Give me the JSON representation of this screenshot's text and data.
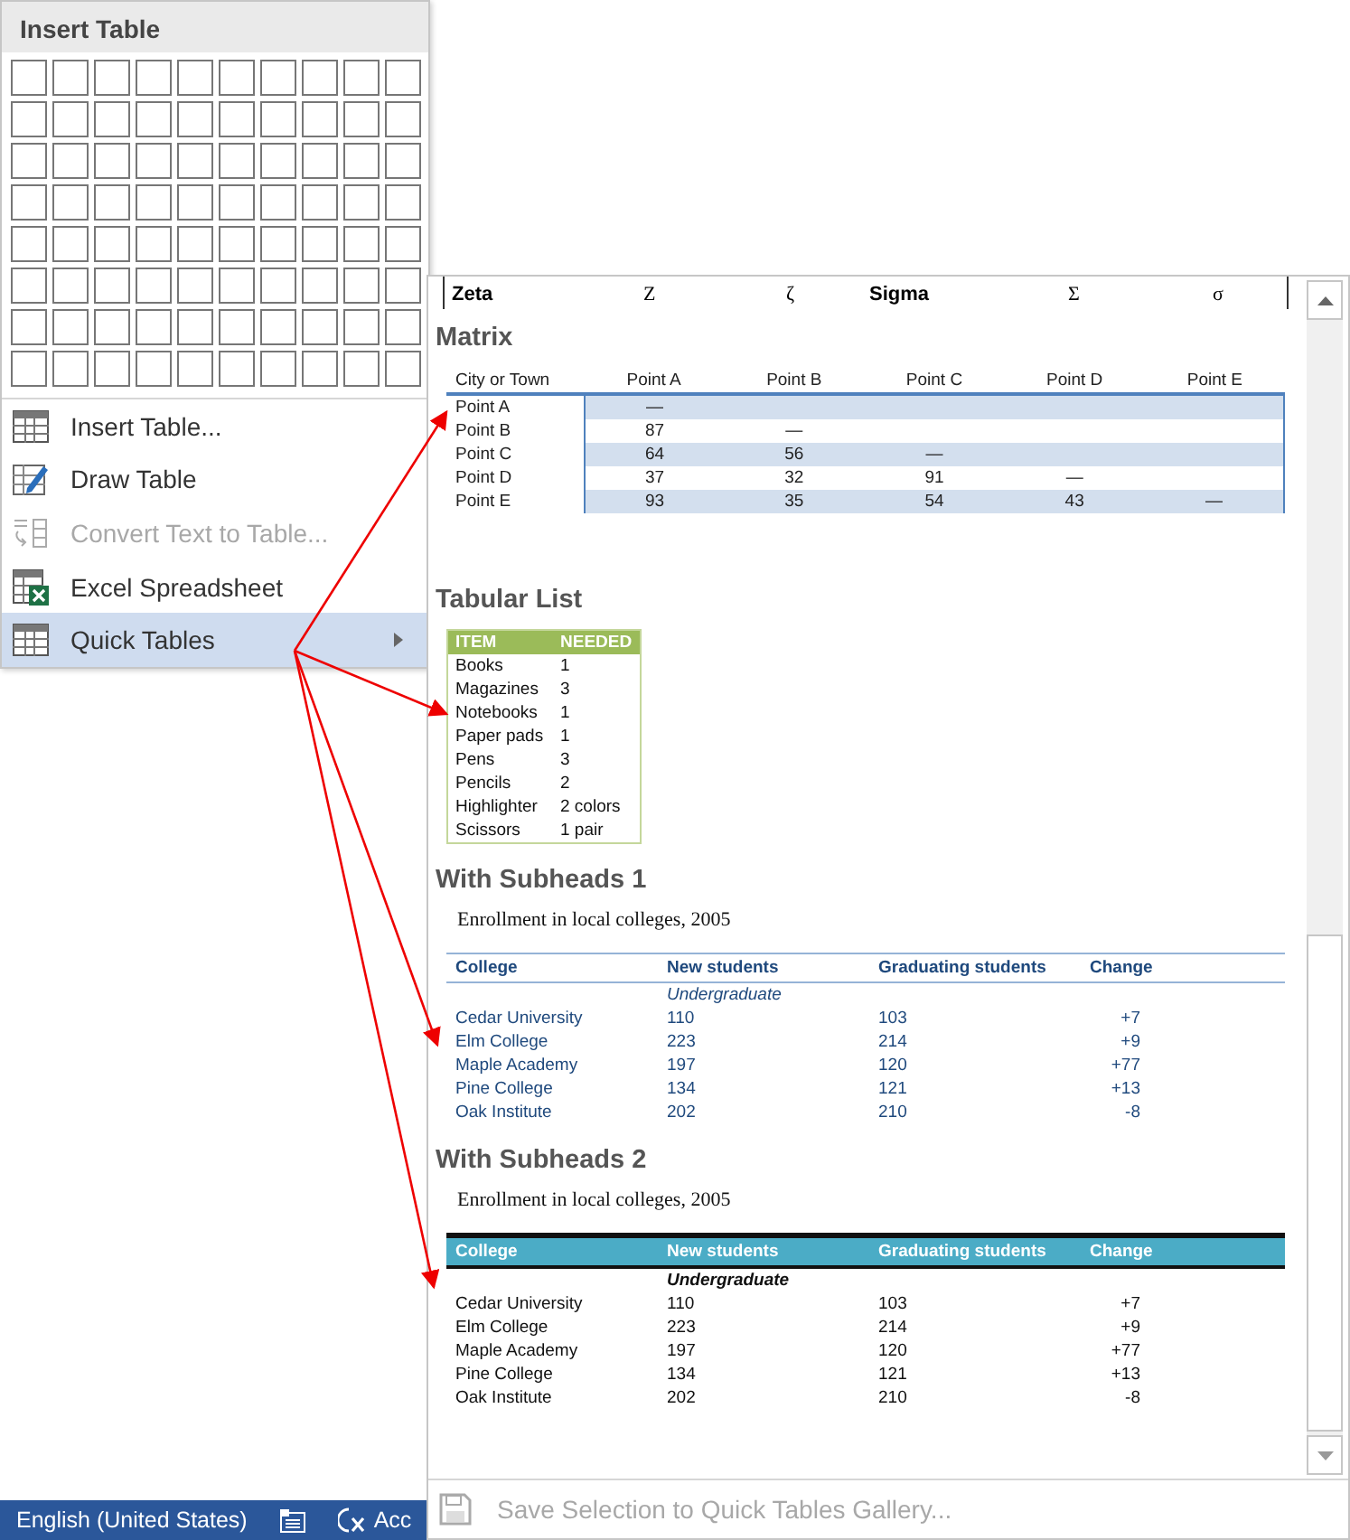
{
  "menu": {
    "title": "Insert Table",
    "items": [
      {
        "kind": "insert",
        "label": "Insert Table...",
        "disabled": false,
        "selected": false,
        "submenu": false
      },
      {
        "kind": "draw",
        "label": "Draw Table",
        "disabled": false,
        "selected": false,
        "submenu": false
      },
      {
        "kind": "convert",
        "label": "Convert Text to Table...",
        "disabled": true,
        "selected": false,
        "submenu": false
      },
      {
        "kind": "excel",
        "label": "Excel Spreadsheet",
        "disabled": false,
        "selected": false,
        "submenu": false
      },
      {
        "kind": "quick",
        "label": "Quick Tables",
        "disabled": false,
        "selected": true,
        "submenu": true
      }
    ]
  },
  "gallery": {
    "partial_row": [
      "Zeta",
      "Ζ",
      "ζ",
      "Sigma",
      "Σ",
      "σ"
    ],
    "sections": [
      {
        "kind": "matrix",
        "title": "Matrix",
        "columns": [
          "City or Town",
          "Point A",
          "Point B",
          "Point C",
          "Point D",
          "Point E"
        ],
        "rows": [
          [
            "Point A",
            "—"
          ],
          [
            "Point B",
            "87",
            "—"
          ],
          [
            "Point C",
            "64",
            "56",
            "—"
          ],
          [
            "Point D",
            "37",
            "32",
            "91",
            "—"
          ],
          [
            "Point E",
            "93",
            "35",
            "54",
            "43",
            "—"
          ]
        ]
      },
      {
        "kind": "list",
        "title": "Tabular List",
        "columns": [
          "ITEM",
          "NEEDED"
        ],
        "rows": [
          [
            "Books",
            "1"
          ],
          [
            "Magazines",
            "3"
          ],
          [
            "Notebooks",
            "1"
          ],
          [
            "Paper pads",
            "1"
          ],
          [
            "Pens",
            "3"
          ],
          [
            "Pencils",
            "2"
          ],
          [
            "Highlighter",
            "2 colors"
          ],
          [
            "Scissors",
            "1 pair"
          ]
        ]
      },
      {
        "kind": "lined",
        "title": "With Subheads 1",
        "caption": "Enrollment in local colleges, 2005",
        "columns": [
          "College",
          "New students",
          "Graduating students",
          "Change"
        ],
        "subhead": "Undergraduate",
        "rows": [
          [
            "Cedar University",
            "110",
            "103",
            "+7"
          ],
          [
            "Elm College",
            "223",
            "214",
            "+9"
          ],
          [
            "Maple Academy",
            "197",
            "120",
            "+77"
          ],
          [
            "Pine College",
            "134",
            "121",
            "+13"
          ],
          [
            "Oak Institute",
            "202",
            "210",
            "-8"
          ]
        ]
      },
      {
        "kind": "banded",
        "title": "With Subheads 2",
        "caption": "Enrollment in local colleges, 2005",
        "columns": [
          "College",
          "New students",
          "Graduating students",
          "Change"
        ],
        "subhead": "Undergraduate",
        "rows": [
          [
            "Cedar University",
            "110",
            "103",
            "+7"
          ],
          [
            "Elm College",
            "223",
            "214",
            "+9"
          ],
          [
            "Maple Academy",
            "197",
            "120",
            "+77"
          ],
          [
            "Pine College",
            "134",
            "121",
            "+13"
          ],
          [
            "Oak Institute",
            "202",
            "210",
            "-8"
          ]
        ]
      }
    ],
    "footer": {
      "label": "Save Selection to Quick Tables Gallery...",
      "disabled": true
    }
  },
  "status_bar": {
    "language": "English (United States)",
    "accessibility": "Acc"
  }
}
